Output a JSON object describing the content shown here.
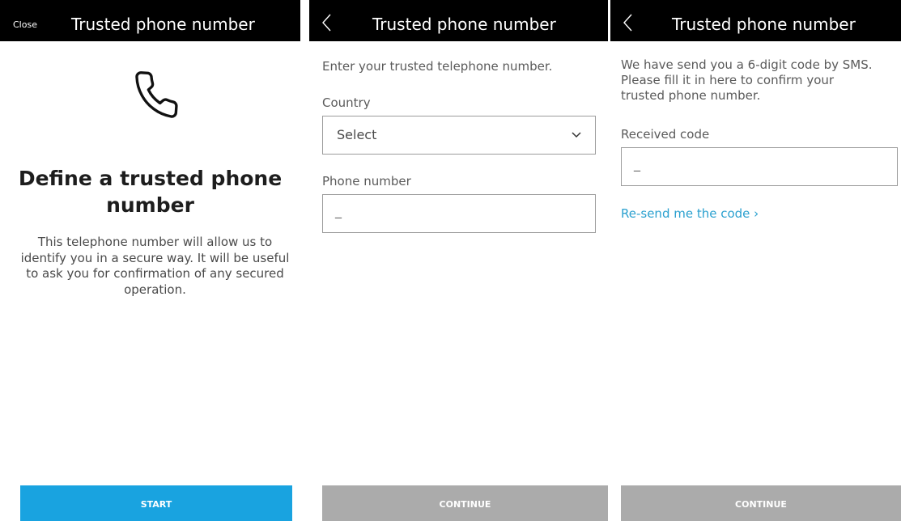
{
  "screens": [
    {
      "topbar": {
        "close_label": "Close",
        "title": "Trusted phone number"
      },
      "icon": "phone-icon",
      "headline": "Define a trusted phone number",
      "body": "This telephone number will allow us to identify you in a secure way. It will be useful to ask you for confirmation of any secured operation.",
      "cta_label": "START"
    },
    {
      "topbar": {
        "back_icon": "chevron-left-icon",
        "title": "Trusted phone number"
      },
      "intro": "Enter your trusted telephone number.",
      "country": {
        "label": "Country",
        "value": "Select"
      },
      "phone": {
        "label": "Phone number",
        "value": "_"
      },
      "cta_label": "CONTINUE"
    },
    {
      "topbar": {
        "back_icon": "chevron-left-icon",
        "title": "Trusted phone number"
      },
      "intro_lines": [
        "We have send you a 6-digit code by SMS.",
        "Please fill it in here to confirm your",
        "trusted phone number."
      ],
      "code": {
        "label": "Received code",
        "value": "_"
      },
      "resend_label": "Re-send me the code ›",
      "cta_label": "CONTINUE"
    }
  ],
  "colors": {
    "topbar": "#000000",
    "primary": "#19a3e0",
    "disabled": "#ababab",
    "link": "#2aa0cf"
  }
}
